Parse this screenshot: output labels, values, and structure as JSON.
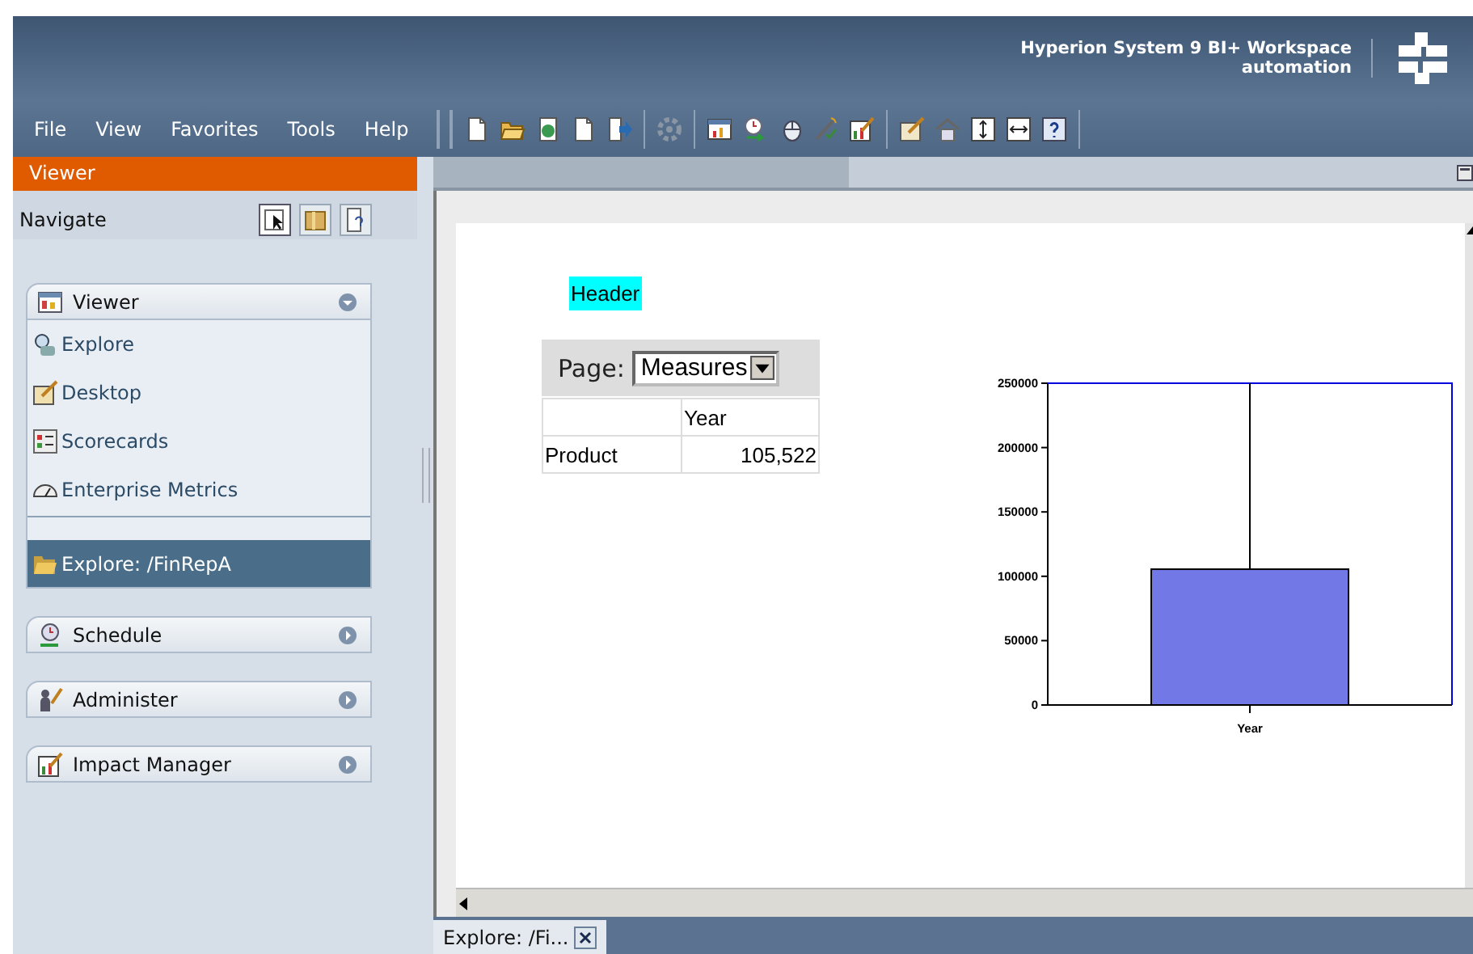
{
  "window": {
    "title": "Hyperion System 9 BI+ Workspace",
    "subtitle": "automation"
  },
  "menu": [
    "File",
    "View",
    "Favorites",
    "Tools",
    "Help"
  ],
  "panel": {
    "title": "Viewer",
    "navigate": "Navigate"
  },
  "sections": [
    {
      "title": "Viewer",
      "expanded": true,
      "items": [
        {
          "label": "Explore"
        },
        {
          "label": "Desktop"
        },
        {
          "label": "Scorecards"
        },
        {
          "label": "Enterprise Metrics"
        }
      ],
      "documents": [
        {
          "label": "Explore: /FinRepA",
          "selected": true
        }
      ]
    },
    {
      "title": "Schedule",
      "expanded": false
    },
    {
      "title": "Administer",
      "expanded": false
    },
    {
      "title": "Impact Manager",
      "expanded": false
    }
  ],
  "document": {
    "header": "Header",
    "page_label": "Page:",
    "page_value": "Measures",
    "column_header": "Year",
    "rows": [
      {
        "label": "Product",
        "value": "105,522"
      }
    ],
    "chart_data": {
      "type": "bar",
      "categories": [
        "Year"
      ],
      "values": [
        105500
      ],
      "errors": [
        [
          105500,
          250000
        ]
      ],
      "ylim": [
        0,
        250000
      ],
      "yticks": [
        0,
        50000,
        100000,
        150000,
        200000,
        250000
      ]
    }
  },
  "tabs": [
    {
      "label": "Explore: /Fi...",
      "selected": true
    }
  ]
}
